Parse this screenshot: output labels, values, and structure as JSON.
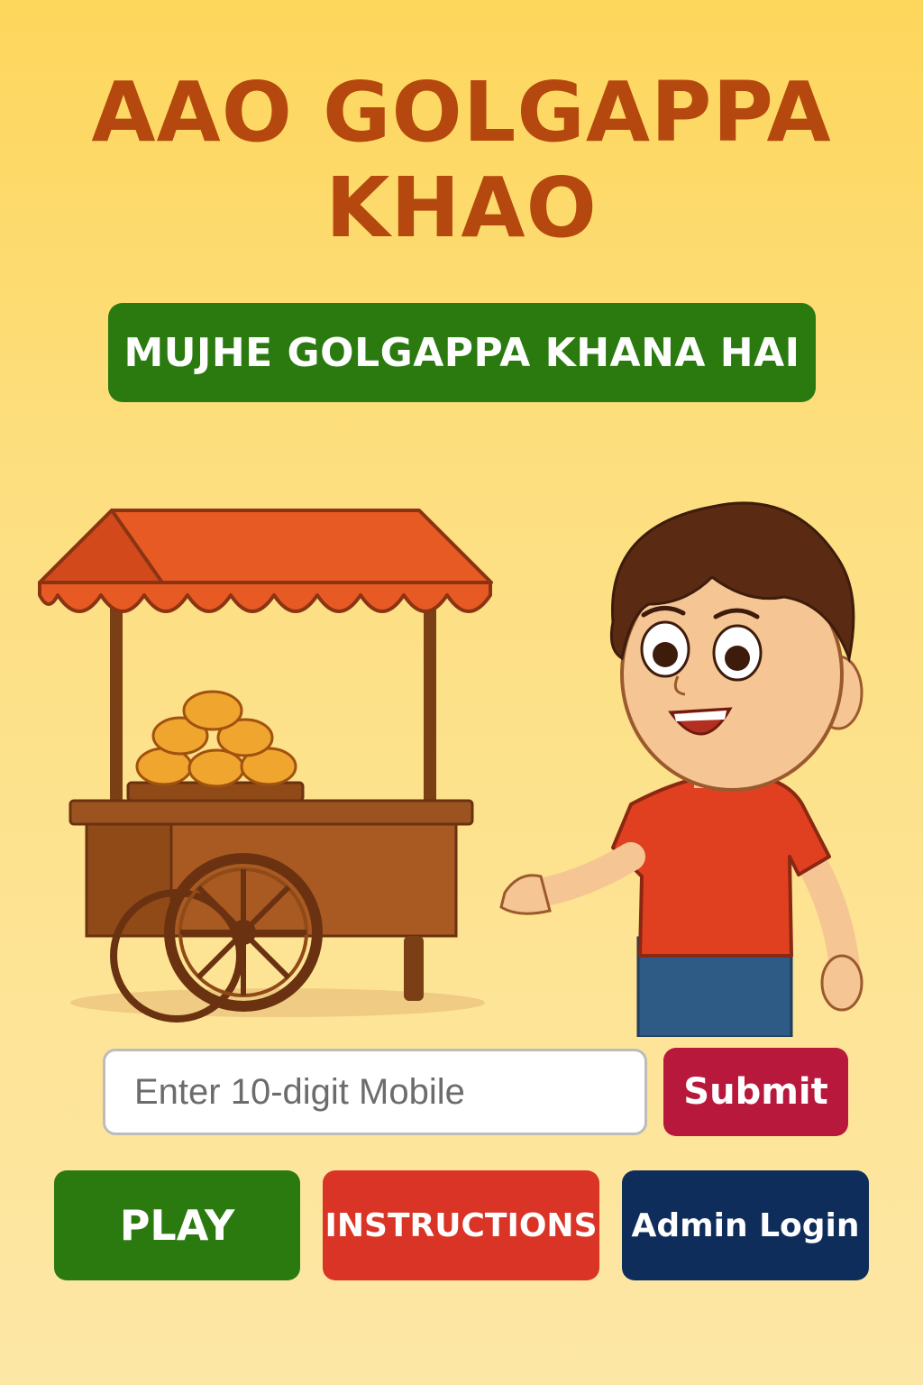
{
  "header": {
    "title_line1": "AAO GOLGAPPA",
    "title_line2": "KHAO"
  },
  "banner": {
    "label": "MUJHE GOLGAPPA KHANA HAI"
  },
  "form": {
    "mobile_placeholder": "Enter 10-digit Mobile",
    "submit_label": "Submit"
  },
  "actions": {
    "play_label": "PLAY",
    "instructions_label": "INSTRUCTIONS",
    "admin_label": "Admin Login"
  },
  "colors": {
    "title": "#b5480f",
    "banner": "#2a7a10",
    "submit": "#b8183c",
    "play": "#2a7a10",
    "instructions": "#d93425",
    "admin": "#0f2d5b"
  },
  "illustration": {
    "icons": [
      "golgappa-cart-icon",
      "happy-boy-icon"
    ]
  }
}
